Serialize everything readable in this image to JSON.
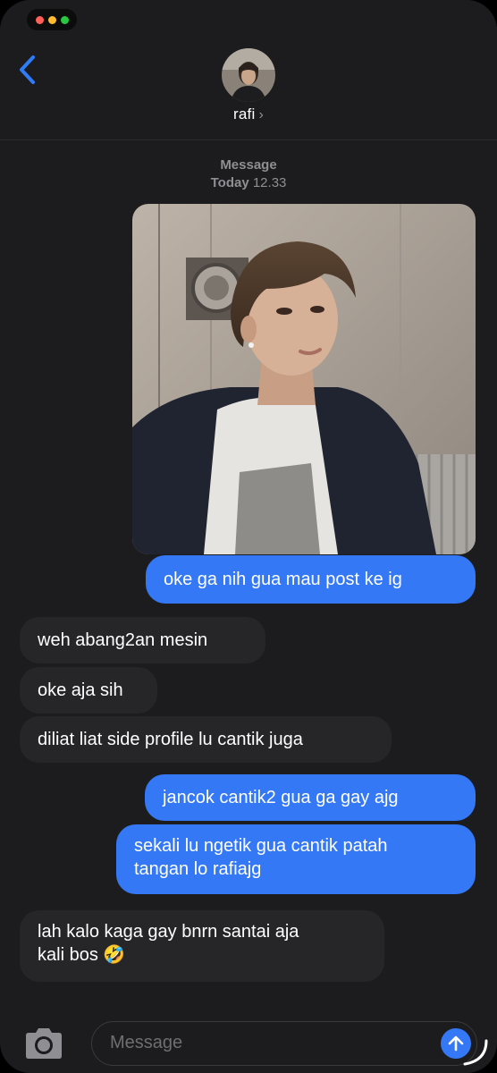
{
  "header": {
    "contact_name": "rafi",
    "name_chevron": "›",
    "back_icon": "chevron-left-icon"
  },
  "thread": {
    "service_label": "Message",
    "timestamp_day": "Today",
    "timestamp_time": "12.33"
  },
  "messages": [
    {
      "direction": "outgoing",
      "type": "image",
      "description_icon": "photo-attachment"
    },
    {
      "direction": "outgoing",
      "text": "oke ga nih gua mau post ke ig"
    },
    {
      "direction": "incoming",
      "text": "weh abang2an mesin"
    },
    {
      "direction": "incoming",
      "text": "oke aja sih"
    },
    {
      "direction": "incoming",
      "text": "diliat liat side profile lu cantik juga"
    },
    {
      "direction": "outgoing",
      "text": "jancok cantik2 gua ga gay ajg"
    },
    {
      "direction": "outgoing",
      "line1": "sekali lu ngetik gua cantik patah",
      "line2": "tangan lo rafiajg"
    },
    {
      "direction": "incoming",
      "line1": "lah kalo kaga gay bnrn santai aja",
      "line2": "kali bos 🤣"
    }
  ],
  "composer": {
    "placeholder": "Message",
    "camera_icon": "camera-icon",
    "send_icon": "arrow-up-icon"
  },
  "colors": {
    "background": "#1c1c1e",
    "outgoing_bubble": "#3478f6",
    "incoming_bubble": "#262628",
    "secondary_text": "#8e8e93"
  }
}
